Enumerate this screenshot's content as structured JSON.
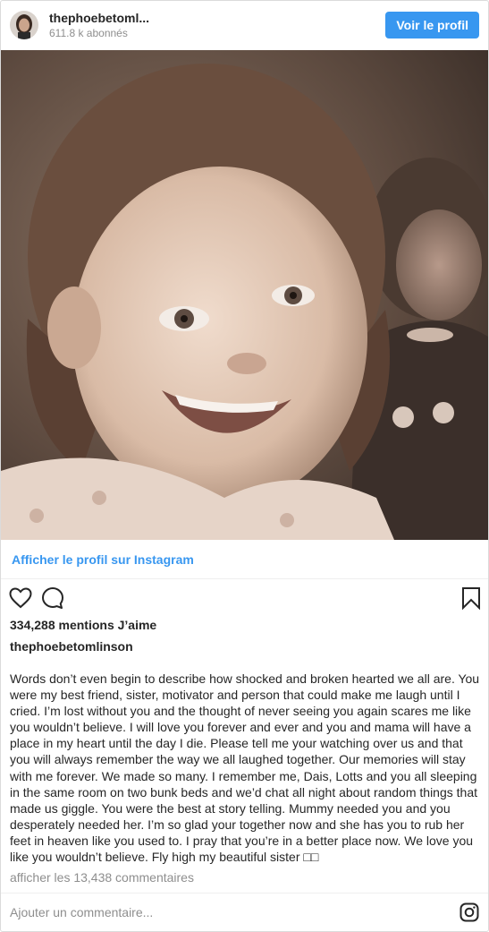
{
  "header": {
    "username": "thephoebetoml...",
    "followers": "611.8 k abonnés",
    "follow_button": "Voir le profil",
    "avatar_icon": "profile-avatar"
  },
  "photo": {
    "description_icon": "photo"
  },
  "profile_link": {
    "label": "Afficher le profil sur Instagram"
  },
  "actions": {
    "like_icon": "heart-icon",
    "comment_icon": "comment-icon",
    "save_icon": "bookmark-icon"
  },
  "likes": {
    "label": "334,288 mentions J’aime"
  },
  "caption": {
    "username": "thephoebetomlinson",
    "text": "Words don’t even begin to describe how shocked and broken hearted we all are. You were my best friend, sister, motivator and person that could make me laugh until I cried. I’m lost without you and the thought of never seeing you again scares me like you wouldn’t believe. I will love you forever and ever and you and mama will have a place in my heart until the day I die. Please tell me your watching over us and that you will always remember the way we all laughed together. Our memories will stay with me forever. We made so many. I remember me, Dais, Lotts and you all sleeping in the same room on two bunk beds and we’d chat all night about random things that made us giggle. You were the best at story telling. Mummy needed you and you desperately needed her. I’m so glad your together now and she has you to rub her feet in heaven like you used to. I pray that you’re in a better place now. We love you like you wouldn’t believe. Fly high my beautiful sister □□"
  },
  "comments": {
    "view_all": "afficher les 13,438 commentaires"
  },
  "comment_box": {
    "placeholder": "Ajouter un commentaire..."
  },
  "colors": {
    "accent": "#3897f0",
    "text": "#262626",
    "muted": "#8e8e8e",
    "border": "#dbdbdb"
  }
}
